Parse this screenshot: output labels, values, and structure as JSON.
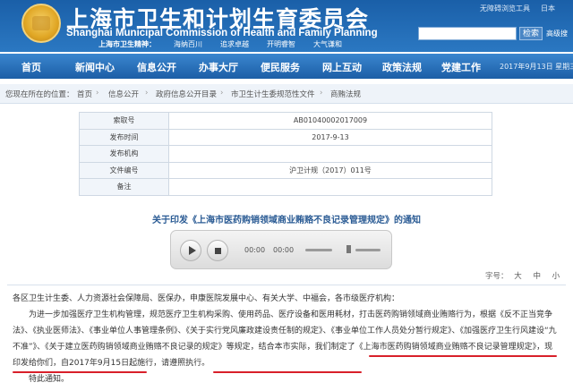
{
  "header": {
    "title_cn": "上海市卫生和计划生育委员会",
    "title_en": "Shanghai Municipal Commission of Health and Family Planning",
    "motto_label": "上海市卫生精神：",
    "motto_items": [
      "海纳百川",
      "追求卓越",
      "开明睿智",
      "大气谦和"
    ],
    "top_links": [
      "无障碍浏览工具",
      "日本"
    ],
    "search_button": "检索",
    "advanced_search": "高级搜"
  },
  "nav": {
    "items": [
      "首页",
      "新闻中心",
      "信息公开",
      "办事大厅",
      "便民服务",
      "网上互动",
      "政策法规",
      "党建工作"
    ],
    "date": "2017年9月13日 星期三"
  },
  "breadcrumb": {
    "prefix": "您现在所在的位置：",
    "items": [
      "首页",
      "信息公开",
      "政府信息公开目录",
      "市卫生计生委规范性文件",
      "商贿法规"
    ]
  },
  "info_table": [
    {
      "key": "索取号",
      "value": "AB01040002017009"
    },
    {
      "key": "发布时间",
      "value": "2017-9-13"
    },
    {
      "key": "发布机构",
      "value": ""
    },
    {
      "key": "文件编号",
      "value": "沪卫计规（2017）011号"
    },
    {
      "key": "备注",
      "value": ""
    }
  ],
  "article": {
    "title": "关于印发《上海市医药购销领域商业贿赂不良记录管理规定》的通知",
    "p1": "各区卫生计生委、人力资源社会保障局、医保办，申康医院发展中心、有关大学、中福会，各市级医疗机构：",
    "p2": "为进一步加强医疗卫生机构管理，规范医疗卫生机构采购、使用药品、医疗设备和医用耗材，打击医药购销领域商业贿赂行为，根据《反不正当竞争法》、《执业医师法》、《事业单位人事管理条例》、《关于实行党风廉政建设责任制的规定》、《事业单位工作人员处分暂行规定》、《加强医疗卫生行风建设“九不准”》、《关于建立医药购销领域商业贿赂不良记录的规定》等规定，结合本市实际，我们制定了《上海市医药购销领域商业贿赂不良记录管理规定》，现印发给你们，自2017年9月15日起施行，请遵照执行。",
    "p3": "特此通知。"
  },
  "player": {
    "current_time": "00:00",
    "total_time": "00:00"
  },
  "font_size": {
    "label": "字号：",
    "options": [
      "大",
      "中",
      "小"
    ]
  },
  "colors": {
    "header_blue": "#1a5fa8",
    "nav_blue": "#2b74be",
    "link_blue": "#2a5b94",
    "underline_red": "#d8202a"
  }
}
